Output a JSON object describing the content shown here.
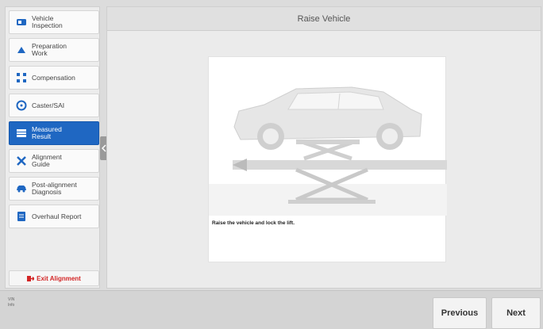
{
  "sidebar": {
    "items": [
      {
        "label": "Vehicle\nInspection",
        "icon": "vehicle-inspection-icon"
      },
      {
        "label": "Preparation\nWork",
        "icon": "preparation-icon"
      },
      {
        "label": "Compensation",
        "icon": "compensation-icon"
      },
      {
        "label": "Caster/SAI",
        "icon": "steering-wheel-icon"
      },
      {
        "label": "Measured\nResult",
        "icon": "measured-result-icon",
        "active": true
      },
      {
        "label": "Alignment\nGuide",
        "icon": "tools-icon"
      },
      {
        "label": "Post-alignment\nDiagnosis",
        "icon": "car-icon"
      },
      {
        "label": "Overhaul Report",
        "icon": "report-icon"
      }
    ],
    "exit_label": "Exit Alignment"
  },
  "main": {
    "title": "Raise Vehicle",
    "instruction": "Raise the vehicle and lock the lift."
  },
  "footer": {
    "vin_label": "VIN",
    "info_label": "Info",
    "previous_label": "Previous",
    "next_label": "Next"
  },
  "colors": {
    "accent": "#1f67c2",
    "exit": "#d32525"
  }
}
